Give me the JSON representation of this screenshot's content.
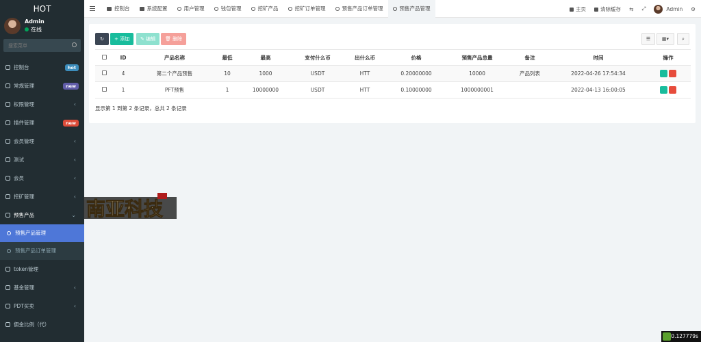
{
  "app": {
    "title": "HOT"
  },
  "user": {
    "name": "Admin",
    "status": "在线"
  },
  "sidebar": {
    "search_placeholder": "搜索菜单",
    "items": [
      {
        "label": "控制台",
        "badge": "hot",
        "badge_color": "#3c8dbc"
      },
      {
        "label": "常规管理",
        "badge": "new",
        "badge_color": "#605ca8"
      },
      {
        "label": "权限管理",
        "arrow": "‹"
      },
      {
        "label": "插件管理",
        "badge": "new",
        "badge_color": "#dd4b39"
      },
      {
        "label": "会员管理",
        "arrow": "‹"
      },
      {
        "label": "测试",
        "arrow": "‹"
      },
      {
        "label": "会员",
        "arrow": "‹"
      },
      {
        "label": "挖矿管理",
        "arrow": "‹"
      },
      {
        "label": "预售产品",
        "arrow": "⌄"
      }
    ],
    "sub_items": [
      {
        "label": "预售产品管理"
      },
      {
        "label": "预售产品订单管理"
      }
    ],
    "items_after": [
      {
        "label": "token管理"
      },
      {
        "label": "基金管理",
        "arrow": "‹"
      },
      {
        "label": "PDT买卖",
        "arrow": "‹"
      },
      {
        "label": "佣金比例（代）"
      }
    ]
  },
  "topnav": {
    "tabs": [
      "控制台",
      "系统配置",
      "用户管理",
      "钱包管理",
      "挖矿产品",
      "挖矿订单管理",
      "预售产品订单管理",
      "预售产品管理"
    ],
    "home": "主页",
    "clear_cache": "清除缓存",
    "admin": "Admin"
  },
  "toolbar": {
    "add": "添加",
    "edit": "编辑",
    "delete": "删除"
  },
  "table": {
    "headers": [
      "ID",
      "产品名称",
      "最低",
      "最高",
      "支付什么币",
      "出什么币",
      "价格",
      "预售产品总量",
      "备注",
      "时间",
      "操作"
    ],
    "rows": [
      [
        "4",
        "第二个产品预售",
        "10",
        "1000",
        "USDT",
        "HTT",
        "0.20000000",
        "10000",
        "产品列表",
        "2022-04-26 17:54:34"
      ],
      [
        "1",
        "PFT预售",
        "1",
        "10000000",
        "USDT",
        "HTT",
        "0.10000000",
        "1000000001",
        "",
        "2022-04-13 16:00:05"
      ]
    ],
    "summary": "显示第 1 到第 2 条记录，总共 2 条记录"
  },
  "logo": {
    "text": "南亚科技",
    "seal": "光荣出品"
  },
  "timer": "0.127779s"
}
